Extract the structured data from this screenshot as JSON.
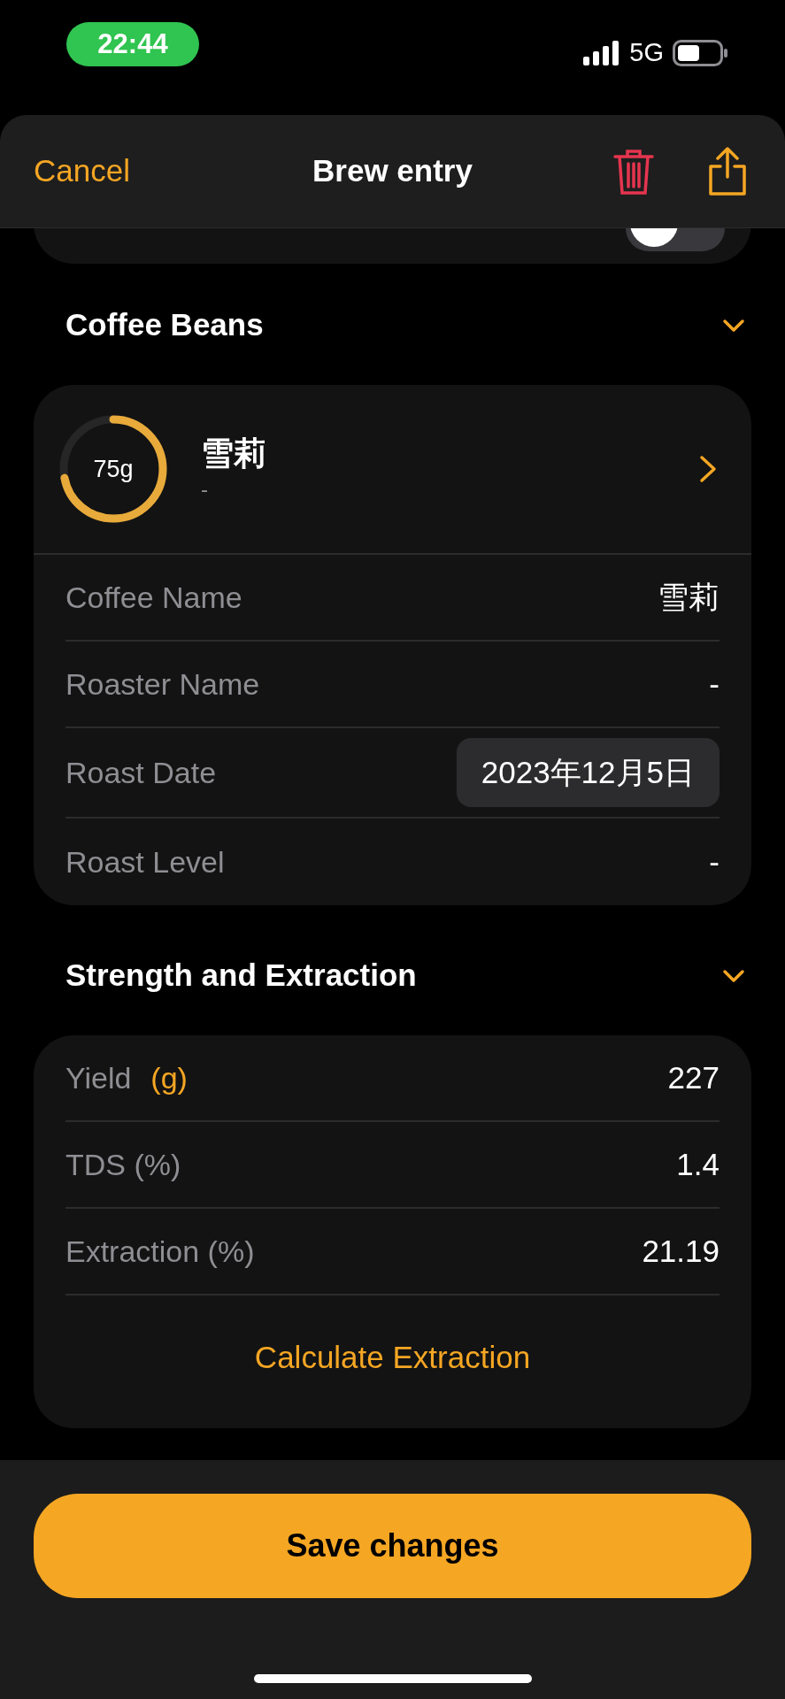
{
  "status_bar": {
    "time": "22:44",
    "network": "5G"
  },
  "nav": {
    "cancel": "Cancel",
    "title": "Brew entry"
  },
  "decaf_toggle": {
    "on": false
  },
  "sections": [
    {
      "title": "Coffee Beans",
      "expanded": true,
      "kind": "beans",
      "bean": {
        "amount": "75g",
        "level": 0.72,
        "name": "雪莉",
        "subtitle": "-"
      },
      "rows": [
        {
          "kind": "text",
          "label": "Coffee Name",
          "value": "雪莉"
        },
        {
          "kind": "text",
          "label": "Roaster Name",
          "value": "-"
        },
        {
          "kind": "date",
          "label": "Roast Date",
          "value": "2023年12月5日"
        },
        {
          "kind": "text",
          "label": "Roast Level",
          "value": "-"
        }
      ]
    },
    {
      "title": "Strength and Extraction",
      "expanded": true,
      "kind": "strength",
      "rows": [
        {
          "kind": "text",
          "label": "Yield",
          "unit": "(g)",
          "value": "227"
        },
        {
          "kind": "text",
          "label": "TDS (%)",
          "value": "1.4"
        },
        {
          "kind": "text",
          "label": "Extraction (%)",
          "value": "21.19"
        }
      ],
      "action": "Calculate Extraction"
    }
  ],
  "save_button": "Save changes"
}
